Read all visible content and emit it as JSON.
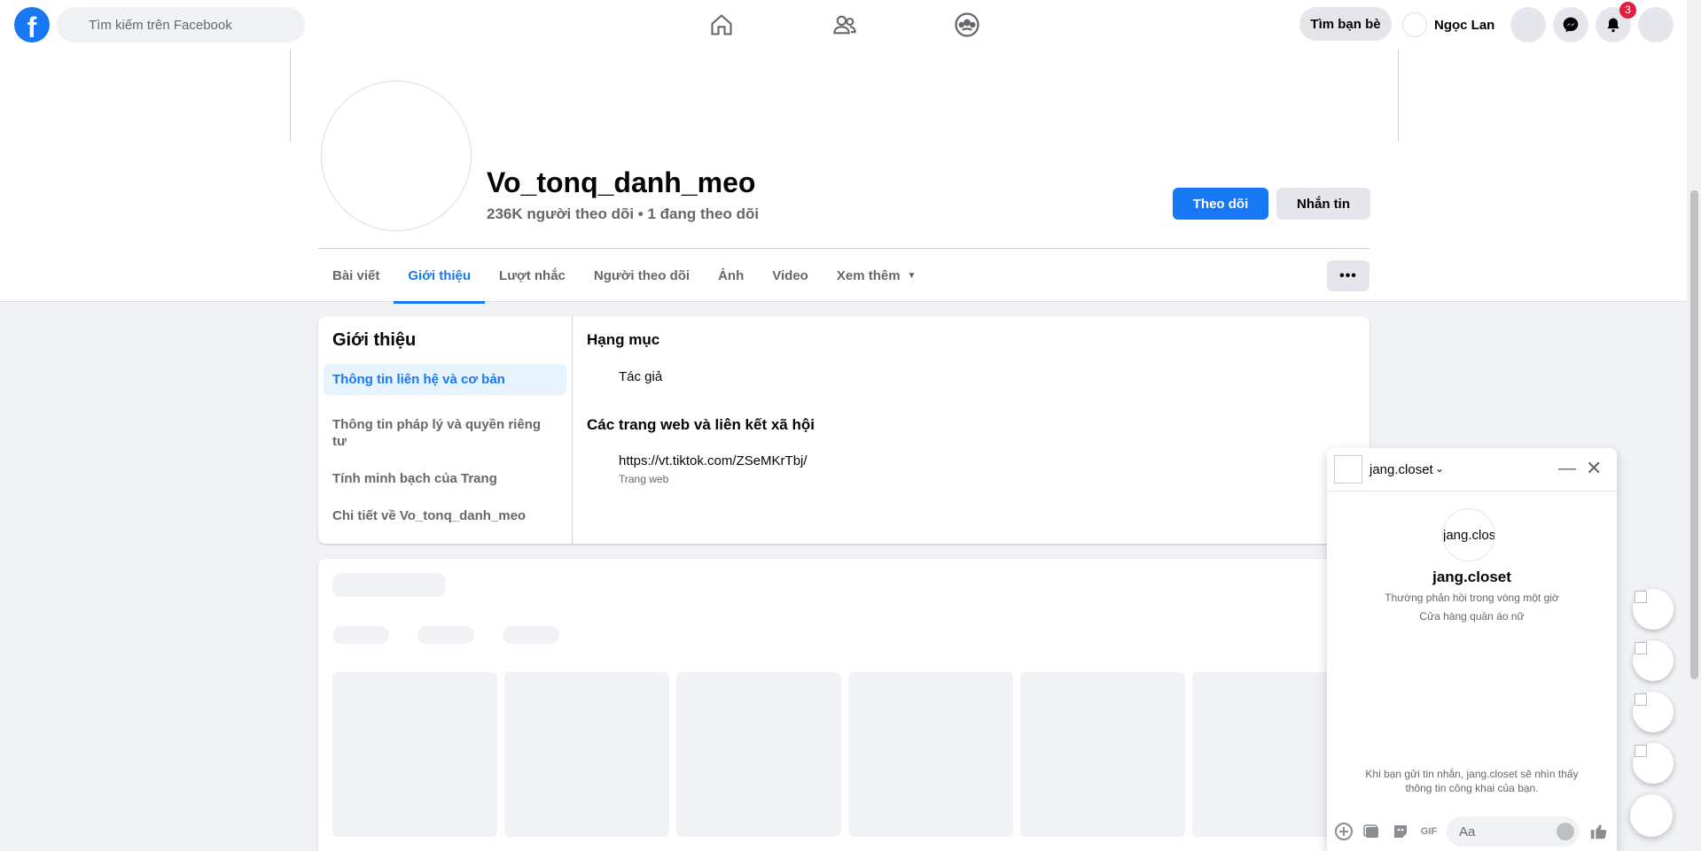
{
  "topbar": {
    "logo_letter": "f",
    "search_placeholder": "Tìm kiếm trên Facebook",
    "find_friends_label": "Tìm bạn bè",
    "user_name": "Ngọc Lan",
    "notifications_count": "3",
    "brand_color": "#1877f2"
  },
  "profile": {
    "name": "Vo_tonq_danh_meo",
    "stats": "236K người theo dõi • 1 đang theo dõi",
    "follow_label": "Theo dõi",
    "message_label": "Nhắn tin"
  },
  "tabs": [
    {
      "label": "Bài viết",
      "active": false
    },
    {
      "label": "Giới thiệu",
      "active": true
    },
    {
      "label": "Lượt nhắc",
      "active": false
    },
    {
      "label": "Người theo dõi",
      "active": false
    },
    {
      "label": "Ảnh",
      "active": false
    },
    {
      "label": "Video",
      "active": false
    },
    {
      "label": "Xem thêm",
      "active": false
    }
  ],
  "more_button_label": "•••",
  "about": {
    "title": "Giới thiệu",
    "nav": [
      "Thông tin liên hệ và cơ bản",
      "Thông tin pháp lý và quyền riêng tư",
      "Tính minh bạch của Trang",
      "Chi tiết về Vo_tonq_danh_meo"
    ],
    "category_title": "Hạng mục",
    "category_value": "Tác giả",
    "links_title": "Các trang web và liên kết xã hội",
    "link_url": "https://vt.tiktok.com/ZSeMKrTbj/",
    "link_type": "Trang web"
  },
  "chat": {
    "name": "jang.closet",
    "avatar_alt": "jang.clos",
    "response_time": "Thường phản hồi trong vòng một giờ",
    "description": "Cửa hàng quần áo nữ",
    "notice": "Khi bạn gửi tin nhắn, jang.closet sẽ nhìn thấy thông tin công khai của bạn.",
    "input_placeholder": "Aa",
    "gif_label": "GIF"
  }
}
